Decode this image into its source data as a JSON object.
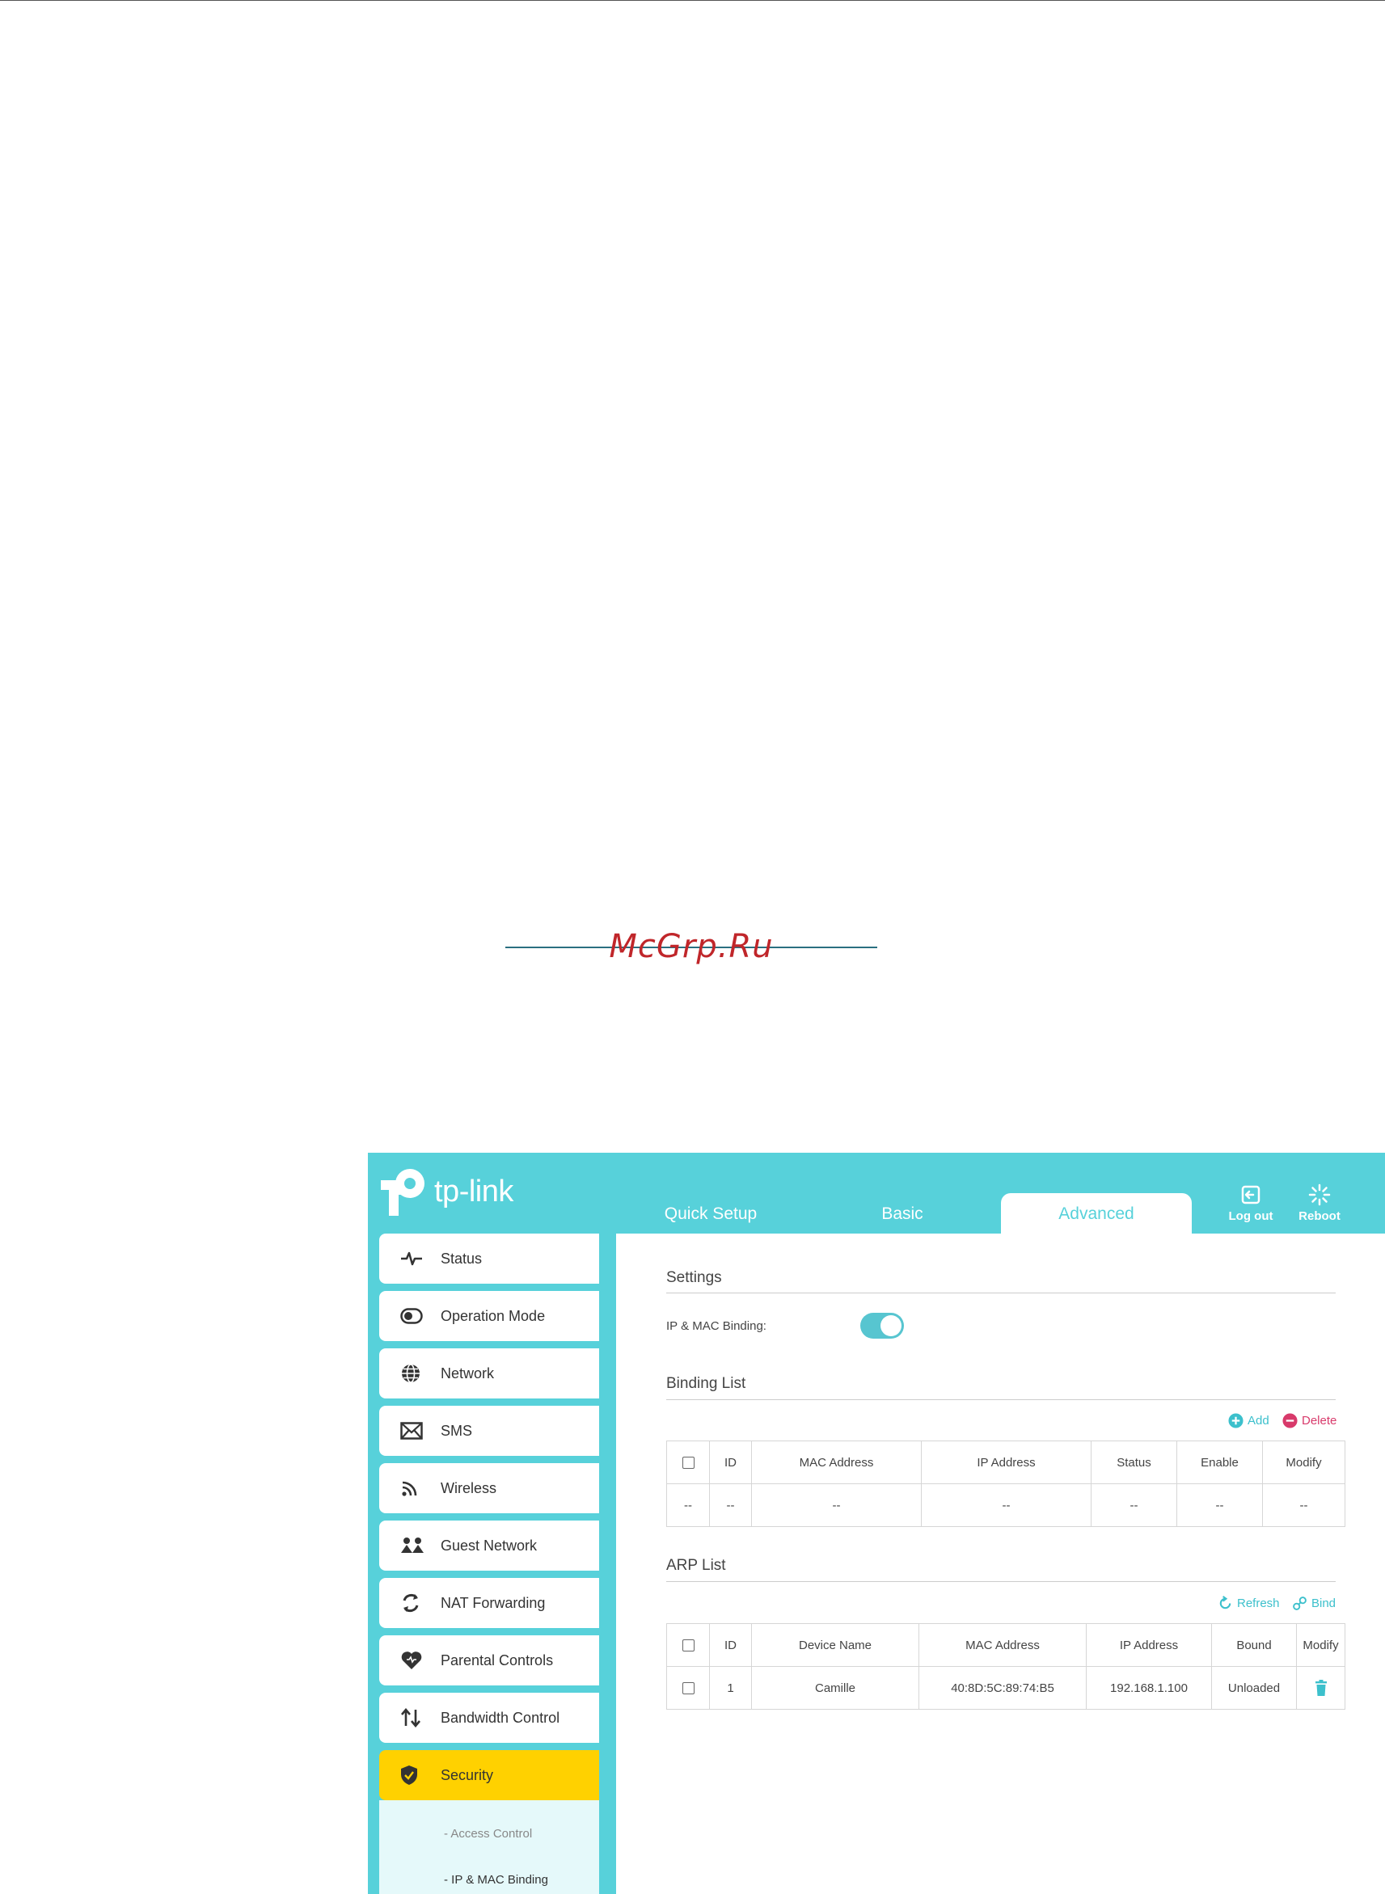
{
  "watermark": "McGrp.Ru",
  "brand": {
    "logo_text": "tp-link"
  },
  "tabs": [
    {
      "label": "Quick Setup"
    },
    {
      "label": "Basic"
    },
    {
      "label": "Advanced",
      "active": true
    }
  ],
  "toolbar": {
    "logout_label": "Log out",
    "reboot_label": "Reboot"
  },
  "sidebar": {
    "items": [
      {
        "label": "Status",
        "icon": "pulse-icon"
      },
      {
        "label": "Operation Mode",
        "icon": "toggle-mode-icon"
      },
      {
        "label": "Network",
        "icon": "globe-icon"
      },
      {
        "label": "SMS",
        "icon": "envelope-icon"
      },
      {
        "label": "Wireless",
        "icon": "wireless-icon"
      },
      {
        "label": "Guest Network",
        "icon": "guests-icon"
      },
      {
        "label": "NAT Forwarding",
        "icon": "nat-icon"
      },
      {
        "label": "Parental Controls",
        "icon": "heart-icon"
      },
      {
        "label": "Bandwidth Control",
        "icon": "arrows-updown-icon"
      },
      {
        "label": "Security",
        "icon": "shield-icon",
        "active": true
      }
    ],
    "submenu": [
      {
        "label": "- Access Control"
      },
      {
        "label": "- IP & MAC Binding",
        "active": true
      }
    ]
  },
  "settings": {
    "title": "Settings",
    "binding_label": "IP & MAC Binding:",
    "binding_enabled": true
  },
  "binding_list": {
    "title": "Binding List",
    "add_label": "Add",
    "delete_label": "Delete",
    "columns": [
      "ID",
      "MAC Address",
      "IP Address",
      "Status",
      "Enable",
      "Modify"
    ],
    "rows": [
      [
        "--",
        "--",
        "--",
        "--",
        "--",
        "--",
        "--"
      ]
    ]
  },
  "arp_list": {
    "title": "ARP List",
    "refresh_label": "Refresh",
    "bind_label": "Bind",
    "columns": [
      "ID",
      "Device Name",
      "MAC Address",
      "IP Address",
      "Bound",
      "Modify"
    ],
    "rows": [
      {
        "id": "1",
        "device": "Camille",
        "mac": "40:8D:5C:89:74:B5",
        "ip": "192.168.1.100",
        "bound": "Unloaded"
      }
    ]
  },
  "colors": {
    "accent": "#57d1da",
    "active_menu": "#ffd100",
    "delete": "#d83a6b"
  }
}
